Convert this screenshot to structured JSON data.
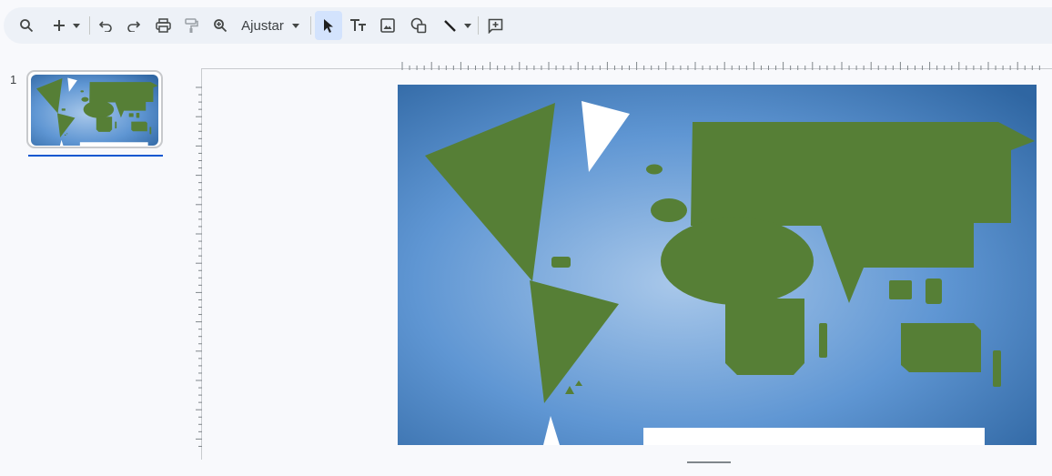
{
  "toolbar": {
    "zoom_label": "Ajustar",
    "icons": [
      "search-icon",
      "add-icon",
      "undo-icon",
      "redo-icon",
      "print-icon",
      "paint-format-icon",
      "zoom-icon",
      "select-icon",
      "text-box-icon",
      "image-icon",
      "shape-icon",
      "line-icon",
      "new-comment-icon"
    ]
  },
  "filmstrip": {
    "slides": [
      {
        "number": "1"
      }
    ]
  },
  "slide": {
    "background": {
      "center": "#a9c8ea",
      "edge": "#2f66a2"
    },
    "land_color": "#567f36"
  },
  "colors": {
    "accent": "#0b57d0",
    "selected_tool_bg": "#d3e3fd"
  }
}
